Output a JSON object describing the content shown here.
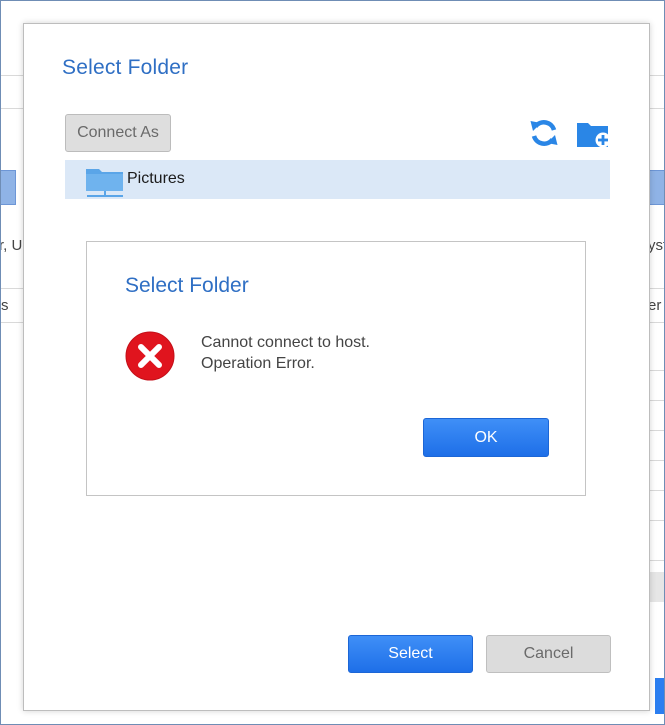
{
  "background_app": {
    "left_text_fragment": "r, U",
    "left_text_fragment_2": "s",
    "right_text_fragment": "yst",
    "right_text_fragment_2": "er"
  },
  "dialog": {
    "title": "Select Folder",
    "connect_as_label": "Connect As",
    "refresh_icon": "refresh-icon",
    "new_folder_icon": "new-folder-icon",
    "folders": [
      {
        "label": "Pictures",
        "icon": "network-folder-icon",
        "selected": true
      }
    ],
    "select_label": "Select",
    "cancel_label": "Cancel"
  },
  "error_dialog": {
    "title": "Select Folder",
    "icon": "error-icon",
    "message_line1": "Cannot connect to host.",
    "message_line2": "Operation Error.",
    "ok_label": "OK"
  },
  "colors": {
    "accent_blue": "#2f6fc4",
    "button_blue": "#1e6fe8",
    "selection_bg": "#dbe8f7",
    "error_red": "#e0141e",
    "folder_blue": "#5aa5e8"
  }
}
